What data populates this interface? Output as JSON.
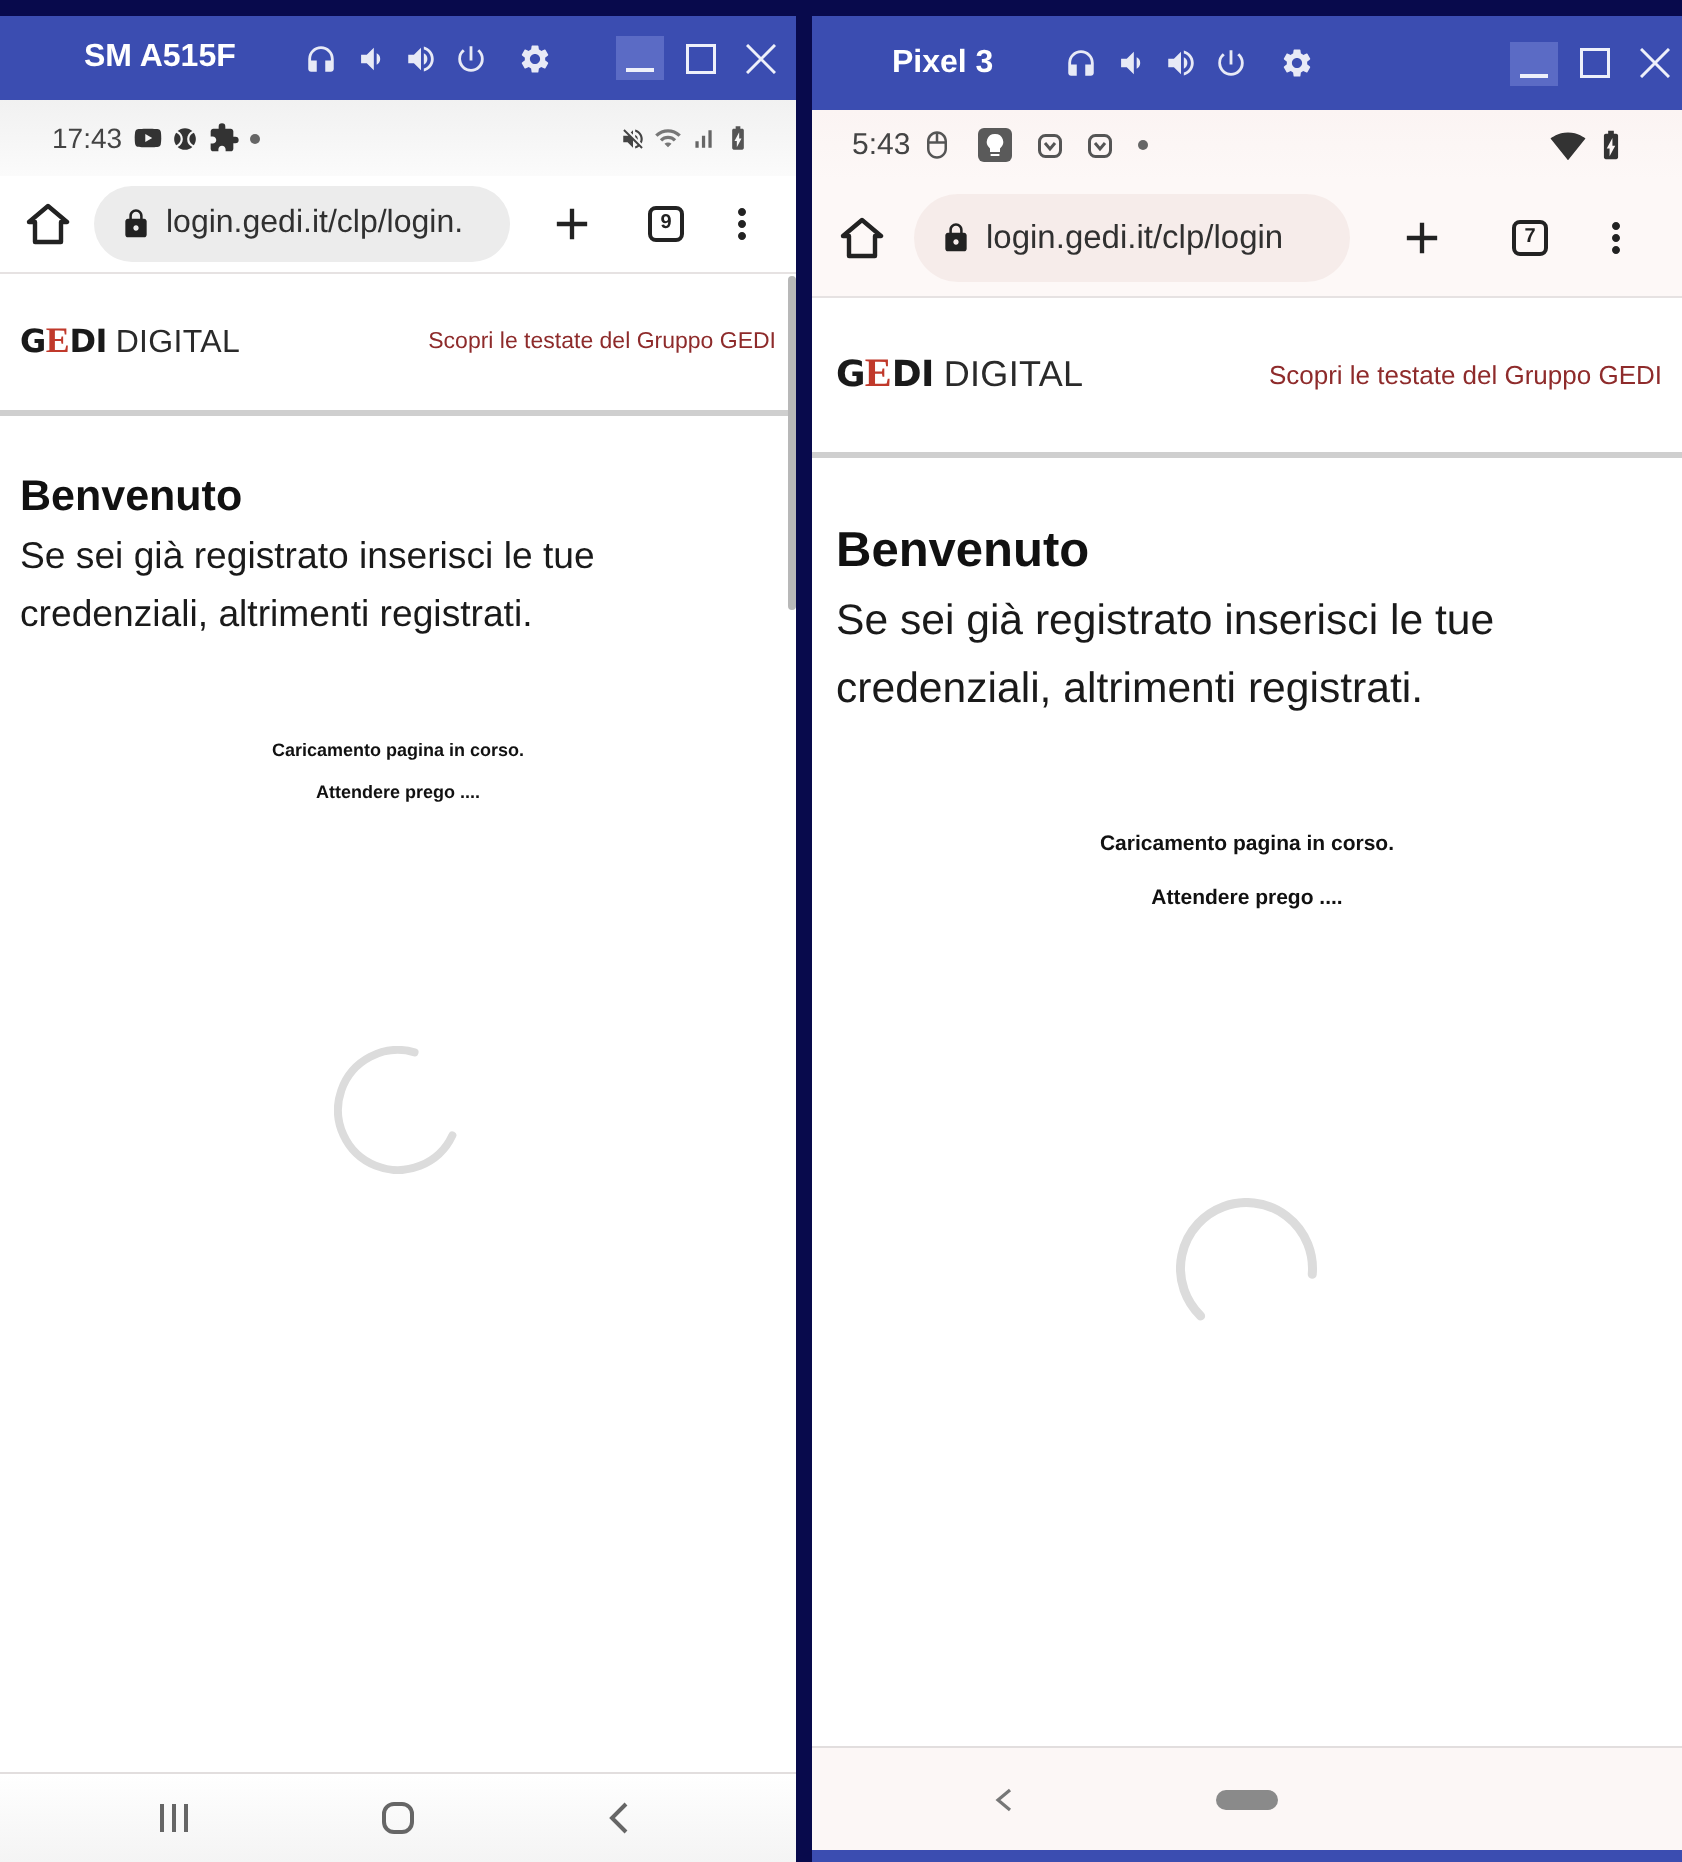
{
  "windows": [
    {
      "kind": "samsung",
      "title": "SM A515F",
      "window_controls": [
        {
          "kind": "minimize",
          "highlighted": true
        },
        {
          "kind": "maximize",
          "highlighted": false
        },
        {
          "kind": "close",
          "highlighted": false
        }
      ],
      "status_bar": {
        "time": "17:43"
      },
      "browser": {
        "url": "login.gedi.it/clp/login.",
        "tab_count": "9"
      },
      "page": {
        "logo": {
          "lead": "G",
          "accent": "E",
          "tail": "DI",
          "wordmark": "DIGITAL"
        },
        "header_link": "Scopri le testate del Gruppo GEDI",
        "heading": "Benvenuto",
        "intro": "Se sei già registrato inserisci le tue credenziali, altrimenti registrati.",
        "loading": [
          "Caricamento pagina in corso.",
          "Attendere prego ...."
        ]
      }
    },
    {
      "kind": "pixel",
      "title": "Pixel 3",
      "window_controls": [
        {
          "kind": "minimize",
          "highlighted": true
        },
        {
          "kind": "maximize",
          "highlighted": false
        },
        {
          "kind": "close",
          "highlighted": false
        }
      ],
      "status_bar": {
        "time": "5:43"
      },
      "browser": {
        "url": "login.gedi.it/clp/login",
        "tab_count": "7"
      },
      "page": {
        "logo": {
          "lead": "G",
          "accent": "E",
          "tail": "DI",
          "wordmark": "DIGITAL"
        },
        "header_link": "Scopri le testate del Gruppo GEDI",
        "heading": "Benvenuto",
        "intro": "Se sei già registrato inserisci le tue credenziali, altrimenti registrati.",
        "loading": [
          "Caricamento pagina in corso.",
          "Attendere prego ...."
        ]
      }
    }
  ]
}
